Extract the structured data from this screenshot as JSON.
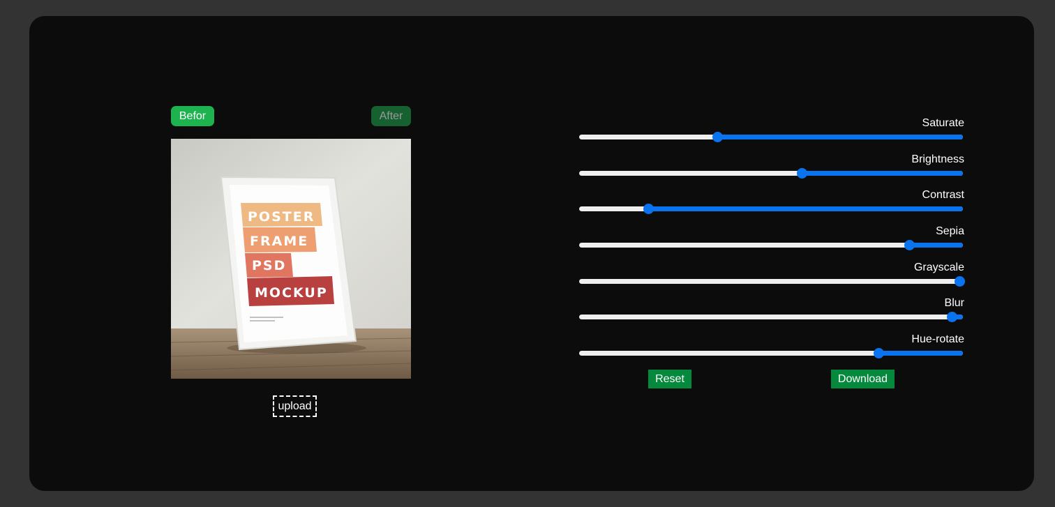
{
  "toggle": {
    "before_label": "Befor",
    "after_label": "After"
  },
  "preview": {
    "poster_lines": [
      "POSTER",
      "FRAME",
      "PSD",
      "MOCKUP"
    ]
  },
  "upload_label": "upload",
  "filters": [
    {
      "label": "Saturate",
      "value": 0.36
    },
    {
      "label": "Brightness",
      "value": 0.58
    },
    {
      "label": "Contrast",
      "value": 0.18
    },
    {
      "label": "Sepia",
      "value": 0.86
    },
    {
      "label": "Grayscale",
      "value": 0.99
    },
    {
      "label": "Blur",
      "value": 0.97
    },
    {
      "label": "Hue-rotate",
      "value": 0.78
    }
  ],
  "actions": {
    "reset_label": "Reset",
    "download_label": "Download"
  },
  "colors": {
    "accent": "#0a73f0",
    "button_green": "#058a3d"
  }
}
